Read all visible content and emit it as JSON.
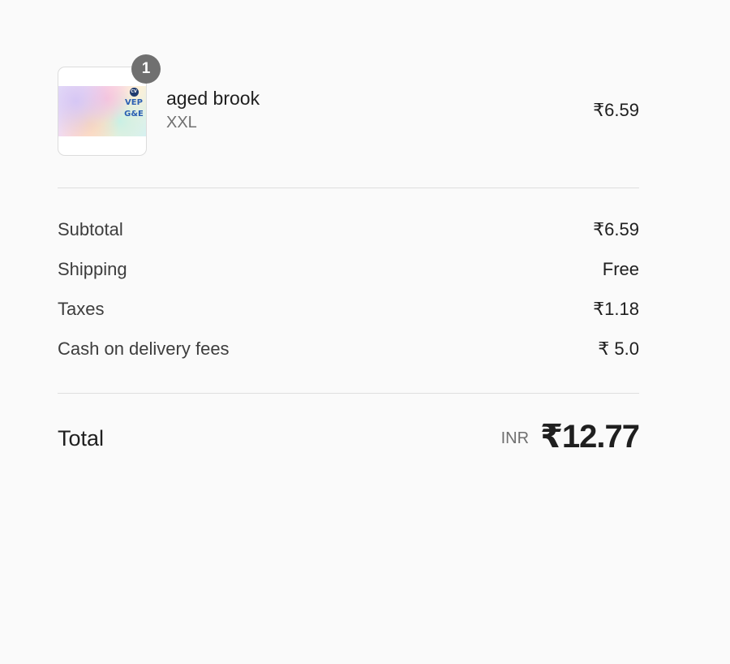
{
  "cart_item": {
    "name": "aged brook",
    "variant": "XXL",
    "price": "₹6.59",
    "quantity": "1",
    "thumbnail_text": {
      "line1": "VEP",
      "line2": "G&E",
      "dot_label": "CV"
    }
  },
  "summary": {
    "subtotal_label": "Subtotal",
    "subtotal_value": "₹6.59",
    "shipping_label": "Shipping",
    "shipping_value": "Free",
    "taxes_label": "Taxes",
    "taxes_value": "₹1.18",
    "cod_label": "Cash on delivery fees",
    "cod_value": "₹ 5.0"
  },
  "total": {
    "label": "Total",
    "currency": "INR",
    "amount": "₹12.77"
  },
  "colors": {
    "background": "#fafafa",
    "text": "#1f1f1f",
    "muted": "#707070",
    "badge": "#707070",
    "divider": "#dedede"
  }
}
